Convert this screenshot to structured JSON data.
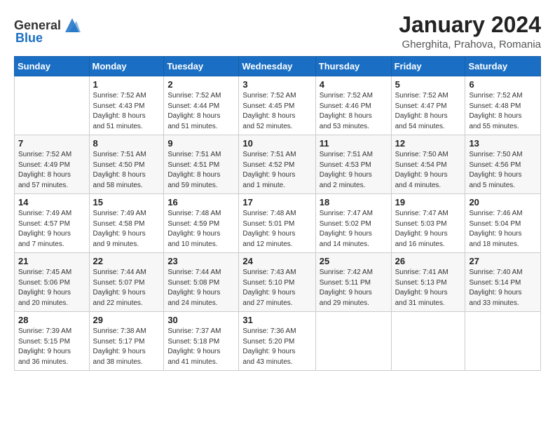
{
  "logo": {
    "text_general": "General",
    "text_blue": "Blue"
  },
  "header": {
    "title": "January 2024",
    "subtitle": "Gherghita, Prahova, Romania"
  },
  "weekdays": [
    "Sunday",
    "Monday",
    "Tuesday",
    "Wednesday",
    "Thursday",
    "Friday",
    "Saturday"
  ],
  "weeks": [
    [
      {
        "day": "",
        "info": ""
      },
      {
        "day": "1",
        "info": "Sunrise: 7:52 AM\nSunset: 4:43 PM\nDaylight: 8 hours\nand 51 minutes."
      },
      {
        "day": "2",
        "info": "Sunrise: 7:52 AM\nSunset: 4:44 PM\nDaylight: 8 hours\nand 51 minutes."
      },
      {
        "day": "3",
        "info": "Sunrise: 7:52 AM\nSunset: 4:45 PM\nDaylight: 8 hours\nand 52 minutes."
      },
      {
        "day": "4",
        "info": "Sunrise: 7:52 AM\nSunset: 4:46 PM\nDaylight: 8 hours\nand 53 minutes."
      },
      {
        "day": "5",
        "info": "Sunrise: 7:52 AM\nSunset: 4:47 PM\nDaylight: 8 hours\nand 54 minutes."
      },
      {
        "day": "6",
        "info": "Sunrise: 7:52 AM\nSunset: 4:48 PM\nDaylight: 8 hours\nand 55 minutes."
      }
    ],
    [
      {
        "day": "7",
        "info": "Sunrise: 7:52 AM\nSunset: 4:49 PM\nDaylight: 8 hours\nand 57 minutes."
      },
      {
        "day": "8",
        "info": "Sunrise: 7:51 AM\nSunset: 4:50 PM\nDaylight: 8 hours\nand 58 minutes."
      },
      {
        "day": "9",
        "info": "Sunrise: 7:51 AM\nSunset: 4:51 PM\nDaylight: 8 hours\nand 59 minutes."
      },
      {
        "day": "10",
        "info": "Sunrise: 7:51 AM\nSunset: 4:52 PM\nDaylight: 9 hours\nand 1 minute."
      },
      {
        "day": "11",
        "info": "Sunrise: 7:51 AM\nSunset: 4:53 PM\nDaylight: 9 hours\nand 2 minutes."
      },
      {
        "day": "12",
        "info": "Sunrise: 7:50 AM\nSunset: 4:54 PM\nDaylight: 9 hours\nand 4 minutes."
      },
      {
        "day": "13",
        "info": "Sunrise: 7:50 AM\nSunset: 4:56 PM\nDaylight: 9 hours\nand 5 minutes."
      }
    ],
    [
      {
        "day": "14",
        "info": "Sunrise: 7:49 AM\nSunset: 4:57 PM\nDaylight: 9 hours\nand 7 minutes."
      },
      {
        "day": "15",
        "info": "Sunrise: 7:49 AM\nSunset: 4:58 PM\nDaylight: 9 hours\nand 9 minutes."
      },
      {
        "day": "16",
        "info": "Sunrise: 7:48 AM\nSunset: 4:59 PM\nDaylight: 9 hours\nand 10 minutes."
      },
      {
        "day": "17",
        "info": "Sunrise: 7:48 AM\nSunset: 5:01 PM\nDaylight: 9 hours\nand 12 minutes."
      },
      {
        "day": "18",
        "info": "Sunrise: 7:47 AM\nSunset: 5:02 PM\nDaylight: 9 hours\nand 14 minutes."
      },
      {
        "day": "19",
        "info": "Sunrise: 7:47 AM\nSunset: 5:03 PM\nDaylight: 9 hours\nand 16 minutes."
      },
      {
        "day": "20",
        "info": "Sunrise: 7:46 AM\nSunset: 5:04 PM\nDaylight: 9 hours\nand 18 minutes."
      }
    ],
    [
      {
        "day": "21",
        "info": "Sunrise: 7:45 AM\nSunset: 5:06 PM\nDaylight: 9 hours\nand 20 minutes."
      },
      {
        "day": "22",
        "info": "Sunrise: 7:44 AM\nSunset: 5:07 PM\nDaylight: 9 hours\nand 22 minutes."
      },
      {
        "day": "23",
        "info": "Sunrise: 7:44 AM\nSunset: 5:08 PM\nDaylight: 9 hours\nand 24 minutes."
      },
      {
        "day": "24",
        "info": "Sunrise: 7:43 AM\nSunset: 5:10 PM\nDaylight: 9 hours\nand 27 minutes."
      },
      {
        "day": "25",
        "info": "Sunrise: 7:42 AM\nSunset: 5:11 PM\nDaylight: 9 hours\nand 29 minutes."
      },
      {
        "day": "26",
        "info": "Sunrise: 7:41 AM\nSunset: 5:13 PM\nDaylight: 9 hours\nand 31 minutes."
      },
      {
        "day": "27",
        "info": "Sunrise: 7:40 AM\nSunset: 5:14 PM\nDaylight: 9 hours\nand 33 minutes."
      }
    ],
    [
      {
        "day": "28",
        "info": "Sunrise: 7:39 AM\nSunset: 5:15 PM\nDaylight: 9 hours\nand 36 minutes."
      },
      {
        "day": "29",
        "info": "Sunrise: 7:38 AM\nSunset: 5:17 PM\nDaylight: 9 hours\nand 38 minutes."
      },
      {
        "day": "30",
        "info": "Sunrise: 7:37 AM\nSunset: 5:18 PM\nDaylight: 9 hours\nand 41 minutes."
      },
      {
        "day": "31",
        "info": "Sunrise: 7:36 AM\nSunset: 5:20 PM\nDaylight: 9 hours\nand 43 minutes."
      },
      {
        "day": "",
        "info": ""
      },
      {
        "day": "",
        "info": ""
      },
      {
        "day": "",
        "info": ""
      }
    ]
  ]
}
